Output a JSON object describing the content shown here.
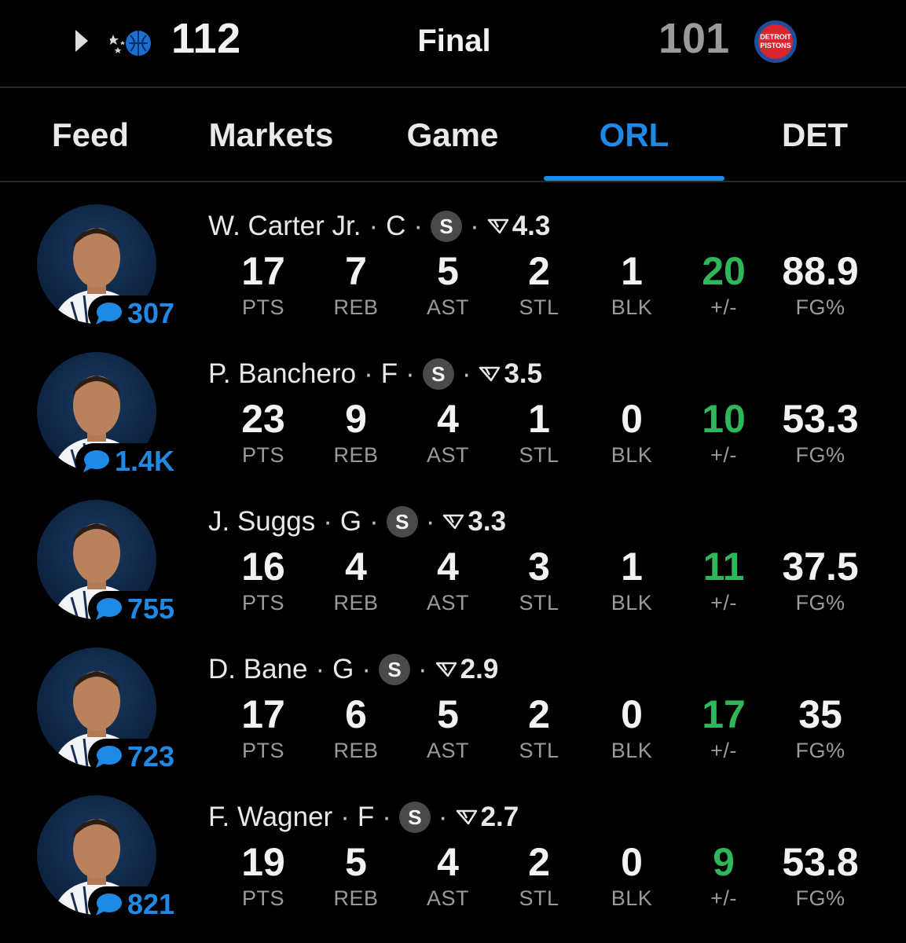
{
  "header": {
    "home_score": "112",
    "status": "Final",
    "away_score": "101",
    "home_logo": "orlando-magic-logo",
    "away_logo": "detroit-pistons-logo",
    "away_logo_text_1": "DETROIT",
    "away_logo_text_2": "PISTONS"
  },
  "tabs": [
    {
      "label": "Feed"
    },
    {
      "label": "Markets"
    },
    {
      "label": "Game"
    },
    {
      "label": "ORL",
      "active": true
    },
    {
      "label": "DET"
    }
  ],
  "stat_labels": [
    "PTS",
    "REB",
    "AST",
    "STL",
    "BLK",
    "+/-",
    "FG%"
  ],
  "players": [
    {
      "name": "W. Carter Jr.",
      "position": "C",
      "badge": "S",
      "rating": "4.3",
      "comments": "307",
      "stats": [
        "17",
        "7",
        "5",
        "2",
        "1",
        "20",
        "88.9"
      ]
    },
    {
      "name": "P. Banchero",
      "position": "F",
      "badge": "S",
      "rating": "3.5",
      "comments": "1.4K",
      "stats": [
        "23",
        "9",
        "4",
        "1",
        "0",
        "10",
        "53.3"
      ]
    },
    {
      "name": "J. Suggs",
      "position": "G",
      "badge": "S",
      "rating": "3.3",
      "comments": "755",
      "stats": [
        "16",
        "4",
        "4",
        "3",
        "1",
        "11",
        "37.5"
      ]
    },
    {
      "name": "D. Bane",
      "position": "G",
      "badge": "S",
      "rating": "2.9",
      "comments": "723",
      "stats": [
        "17",
        "6",
        "5",
        "2",
        "0",
        "17",
        "35"
      ]
    },
    {
      "name": "F. Wagner",
      "position": "F",
      "badge": "S",
      "rating": "2.7",
      "comments": "821",
      "stats": [
        "19",
        "5",
        "4",
        "2",
        "0",
        "9",
        "53.8"
      ]
    }
  ],
  "colors": {
    "accent": "#1e8ae6",
    "positive": "#2fb55a",
    "muted": "#9a9a9a",
    "background": "#000000"
  }
}
